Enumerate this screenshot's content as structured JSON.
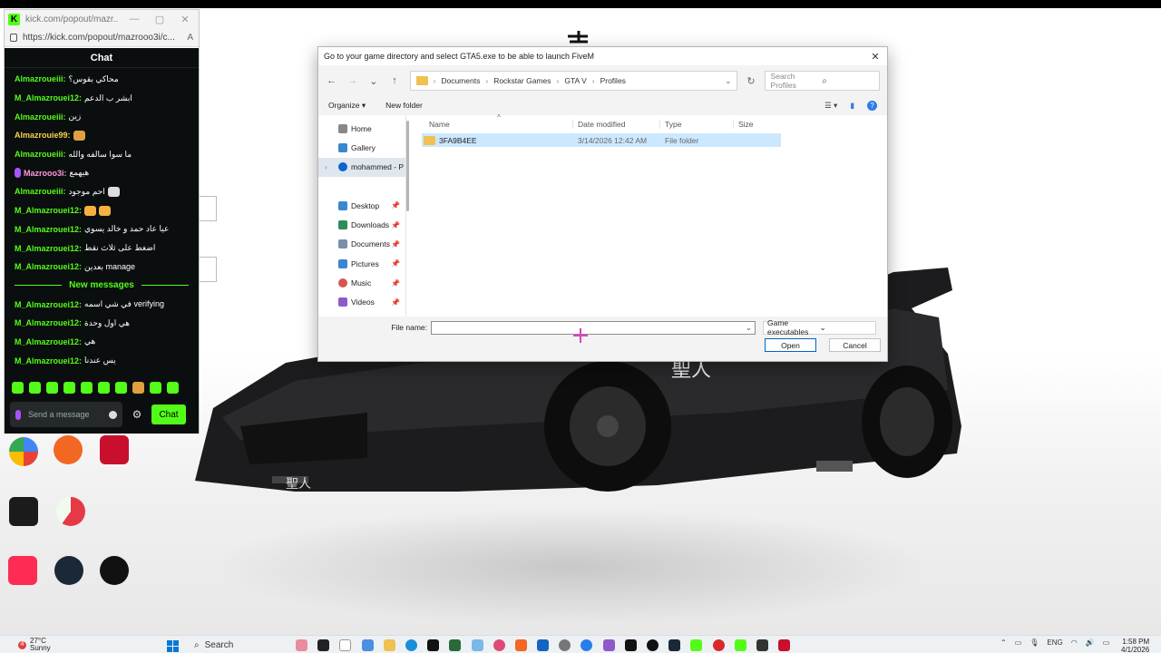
{
  "kick_window": {
    "title": "kick.com/popout/mazr...",
    "url": "https://kick.com/popout/mazrooo3i/c...",
    "chat_header": "Chat",
    "messages": [
      {
        "user": "Almazroueiii:",
        "text": "محاكي بقوس؟",
        "color": "#53fc18"
      },
      {
        "user": "M_Almazrouei12:",
        "text": "ابشر ب الدعم",
        "color": "#53fc18"
      },
      {
        "user": "Almazroueiii:",
        "text": "زين",
        "color": "#53fc18"
      },
      {
        "user": "Almazrouie99:",
        "text": "",
        "color": "#f5d547"
      },
      {
        "user": "Almazroueiii:",
        "text": "ما سوا سالفه والله",
        "color": "#53fc18"
      },
      {
        "user": "Mazrooo3i:",
        "text": "هيهمع",
        "color": "#ff9ad8"
      },
      {
        "user": "Almazroueiii:",
        "text": "احم موجود",
        "color": "#53fc18"
      },
      {
        "user": "M_Almazrouei12:",
        "text": "",
        "color": "#53fc18"
      },
      {
        "user": "M_Almazrouei12:",
        "text": "عيا عاد حمد و خالد يسوي",
        "color": "#53fc18"
      },
      {
        "user": "M_Almazrouei12:",
        "text": "اضغط على ثلاث نقط",
        "color": "#53fc18"
      },
      {
        "user": "M_Almazrouei12:",
        "text": "بعدين manage",
        "color": "#53fc18"
      }
    ],
    "new_messages_label": "New messages",
    "new_messages": [
      {
        "user": "M_Almazrouei12:",
        "text": "في شي اسمه verifying",
        "color": "#53fc18"
      },
      {
        "user": "M_Almazrouei12:",
        "text": "هي اول وحدة",
        "color": "#53fc18"
      },
      {
        "user": "M_Almazrouei12:",
        "text": "هي",
        "color": "#53fc18"
      },
      {
        "user": "M_Almazrouei12:",
        "text": "يس عندنا",
        "color": "#53fc18"
      }
    ],
    "input_placeholder": "Send a message",
    "send_label": "Chat"
  },
  "dialog": {
    "title": "Go to your game directory and select GTA5.exe to be able to launch FiveM",
    "breadcrumb": [
      "Documents",
      "Rockstar Games",
      "GTA V",
      "Profiles"
    ],
    "search_placeholder": "Search Profiles",
    "toolbar": {
      "organize": "Organize",
      "new_folder": "New folder"
    },
    "nav_items": [
      {
        "label": "Home",
        "pinned": false
      },
      {
        "label": "Gallery",
        "pinned": false
      },
      {
        "label": "mohammed - P",
        "pinned": false
      },
      {
        "label": "Desktop",
        "pinned": true
      },
      {
        "label": "Downloads",
        "pinned": true
      },
      {
        "label": "Documents",
        "pinned": true
      },
      {
        "label": "Pictures",
        "pinned": true
      },
      {
        "label": "Music",
        "pinned": true
      },
      {
        "label": "Videos",
        "pinned": true
      }
    ],
    "columns": {
      "name": "Name",
      "date": "Date modified",
      "type": "Type",
      "size": "Size"
    },
    "files": [
      {
        "name": "3FA9B4EE",
        "date": "3/14/2026 12:42 AM",
        "type": "File folder",
        "size": ""
      }
    ],
    "file_name_label": "File name:",
    "file_name_value": "",
    "filter": "Game executables",
    "open_label": "Open",
    "cancel_label": "Cancel"
  },
  "taskbar": {
    "weather_temp": "27°C",
    "weather_desc": "Sunny",
    "weather_badge": "4",
    "search_label": "Search",
    "language": "ENG",
    "time": "1:58 PM",
    "date": "4/1/2026"
  },
  "colors": {
    "kick_green": "#53fc18",
    "chat_bg": "#0b0e0f",
    "dialog_bg": "#f3f3f3",
    "selected_row": "#cce8ff",
    "accent_blue": "#0067c0"
  }
}
